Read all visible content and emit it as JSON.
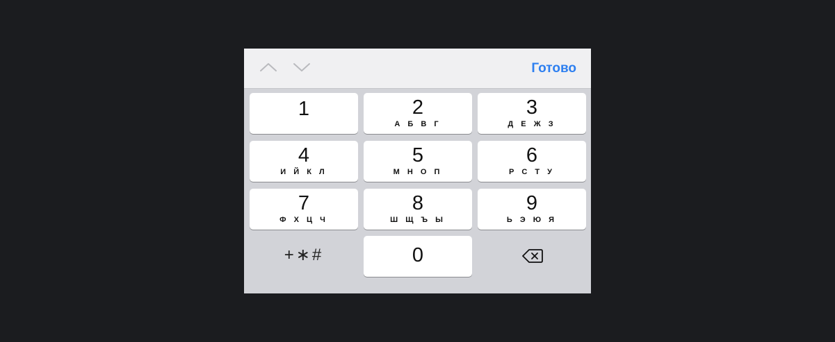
{
  "toolbar": {
    "prev_icon": "chevron-up-icon",
    "next_icon": "chevron-down-icon",
    "done_label": "Готово",
    "done_color": "#2d7ff0"
  },
  "keys": [
    {
      "digit": "1",
      "letters": ""
    },
    {
      "digit": "2",
      "letters": "А Б В Г"
    },
    {
      "digit": "3",
      "letters": "Д Е Ж З"
    },
    {
      "digit": "4",
      "letters": "И Й К Л"
    },
    {
      "digit": "5",
      "letters": "М Н О П"
    },
    {
      "digit": "6",
      "letters": "Р С Т У"
    },
    {
      "digit": "7",
      "letters": "Ф Х Ц Ч"
    },
    {
      "digit": "8",
      "letters": "Ш Щ Ъ Ы"
    },
    {
      "digit": "9",
      "letters": "Ь Э Ю Я"
    },
    {
      "digit": "0",
      "letters": ""
    }
  ],
  "symbols_label": "+∗#",
  "backspace_icon": "backspace-icon",
  "colors": {
    "background": "#1b1c1f",
    "keyboard": "#d2d3d8",
    "key": "#ffffff",
    "toolbar": "#f0f0f2"
  }
}
